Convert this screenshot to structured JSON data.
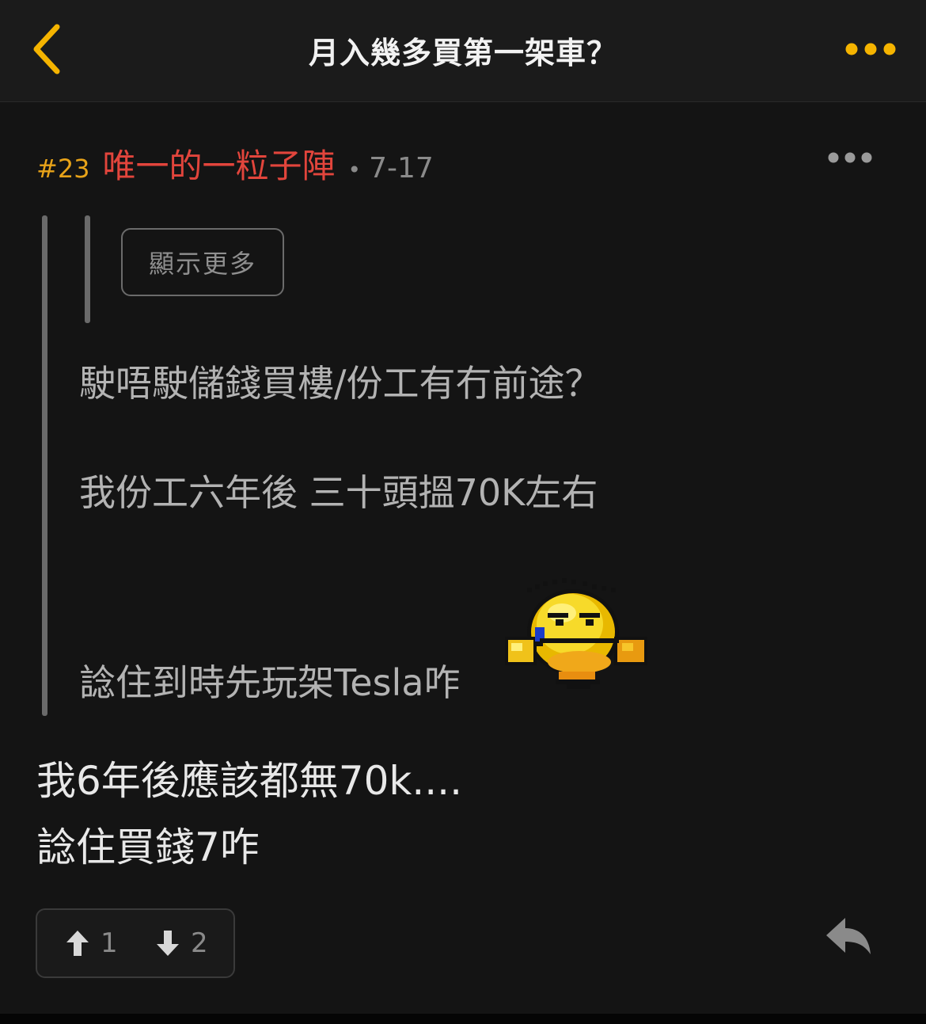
{
  "header": {
    "title": "月入幾多買第一架車？",
    "accent_color": "#F5B400"
  },
  "post": {
    "number": "#23",
    "author": "唯一的一粒子陣",
    "separator": "•",
    "date": "7-17",
    "quote": {
      "show_more_label": "顯示更多",
      "lines": [
        "駛唔駛儲錢買樓/份工有冇前途？",
        "我份工六年後 三十頭搵70K左右",
        "諗住到時先玩架Tesla咋"
      ],
      "sticker": "crying-smiley-sticker"
    },
    "body_lines": [
      "我6年後應該都無70k....",
      "諗住買錢7咋"
    ],
    "upvotes": "1",
    "downvotes": "2"
  },
  "colors": {
    "post_number": "#E8A319",
    "author": "#E2453C",
    "meta": "#8A8A8A",
    "quote_text": "#B3B3B3",
    "body_text": "#E8E8E8"
  },
  "icons": {
    "back": "chevron-left-icon",
    "header_more": "more-dots-icon",
    "post_more": "more-dots-icon",
    "upvote": "arrow-up-icon",
    "downvote": "arrow-down-icon",
    "reply": "reply-icon"
  }
}
